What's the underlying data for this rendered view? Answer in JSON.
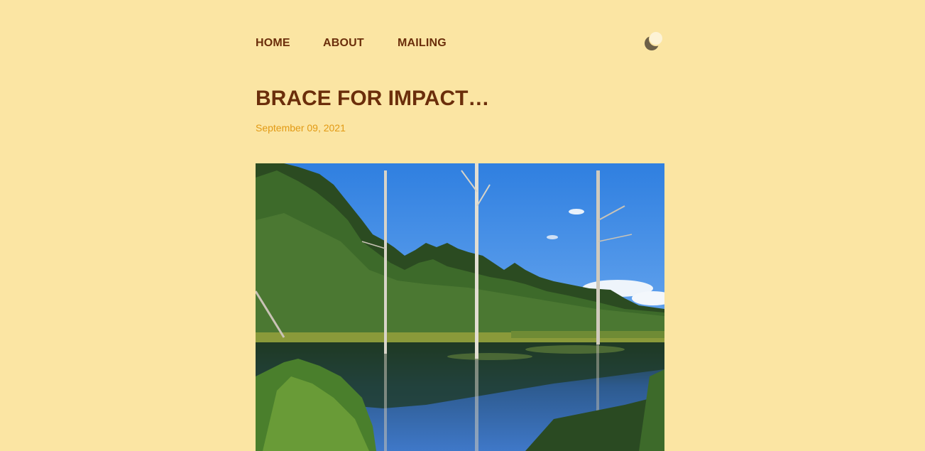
{
  "nav": {
    "items": [
      {
        "label": "HOME"
      },
      {
        "label": "ABOUT"
      },
      {
        "label": "MAILING"
      }
    ],
    "theme_toggle_icon": "moon-icon"
  },
  "post": {
    "title": "BRACE FOR IMPACT…",
    "date": "September 09, 2021",
    "image_subject": "pond-landscape-photo"
  },
  "colors": {
    "background": "#fbe5a3",
    "heading": "#6b2e0b",
    "date": "#e29a14"
  }
}
